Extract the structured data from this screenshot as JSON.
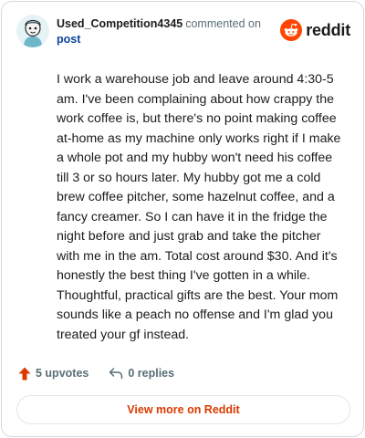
{
  "comment": {
    "author": "Used_Competition4345",
    "action": "commented on",
    "post_link": "post",
    "body": "I work a warehouse job and leave around 4:30-5 am. I've been complaining about how crappy the work coffee is, but there's no point making coffee at-home as my machine only works right if I make a whole pot and my hubby won't need his coffee till 3 or so hours later. My hubby got me a cold brew coffee pitcher, some hazelnut coffee, and a fancy creamer. So I can have it in the fridge the night before and just grab and take the pitcher with me in the am. Total cost around $30. And it's honestly the best thing I've gotten in a while. Thoughtful, practical gifts are the best. Your mom sounds like a peach no offense and I'm glad you treated your gf instead."
  },
  "brand": {
    "name": "reddit",
    "icon": "reddit-logo-icon",
    "color": "#ff4500"
  },
  "stats": {
    "upvotes_label": "5 upvotes",
    "upvote_icon": "upvote-arrow-icon",
    "upvote_color": "#d93a00",
    "replies_label": "0 replies",
    "reply_icon": "reply-arrow-icon"
  },
  "footer": {
    "view_more_label": "View more on Reddit"
  }
}
